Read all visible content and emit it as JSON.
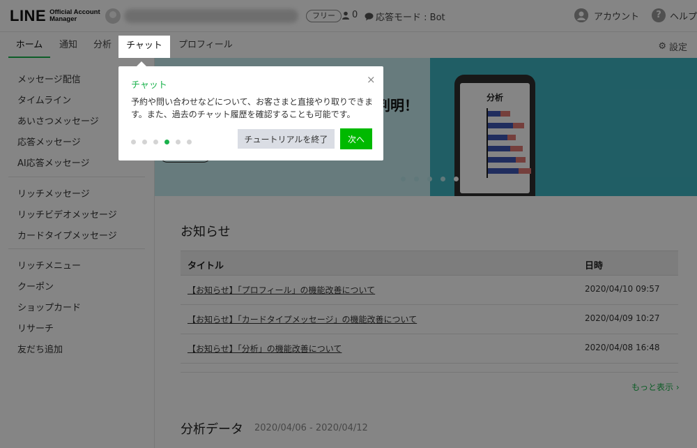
{
  "header": {
    "logo_main": "LINE",
    "logo_sub_1": "Official Account",
    "logo_sub_2": "Manager",
    "plan_badge": "フリー",
    "friend_count": "0",
    "response_mode": "応答モード : Bot",
    "account_label": "アカウント",
    "help_label": "ヘルプ"
  },
  "tabs": [
    {
      "label": "ホーム"
    },
    {
      "label": "通知"
    },
    {
      "label": "分析"
    },
    {
      "label": "チャット"
    },
    {
      "label": "プロフィール"
    }
  ],
  "settings_label": "設定",
  "sidebar": {
    "group1": [
      "メッセージ配信",
      "タイムライン",
      "あいさつメッセージ",
      "応答メッセージ",
      "AI応答メッセージ"
    ],
    "group2": [
      "リッチメッセージ",
      "リッチビデオメッセージ",
      "カードタイプメッセージ"
    ],
    "group3": [
      "リッチメニュー",
      "クーポン",
      "ショップカード",
      "リサーチ",
      "友だち追加"
    ]
  },
  "banner": {
    "headline_fragment": "判明！",
    "phone_title": "分析"
  },
  "news": {
    "heading": "お知らせ",
    "col_title": "タイトル",
    "col_date": "日時",
    "rows": [
      {
        "title": "【お知らせ】「プロフィール」の機能改善について",
        "date": "2020/04/10 09:57"
      },
      {
        "title": "【お知らせ】「カードタイプメッセージ」の機能改善について",
        "date": "2020/04/09 10:27"
      },
      {
        "title": "【お知らせ】「分析」の機能改善について",
        "date": "2020/04/08 16:48"
      }
    ],
    "more": "もっと表示"
  },
  "analytics": {
    "heading": "分析データ",
    "range": "2020/04/06 - 2020/04/12"
  },
  "tutorial": {
    "title": "チャット",
    "body": "予約や問い合わせなどについて、お客さまと直接やり取りできます。また、過去のチャット履歴を確認することも可能です。",
    "step_current": 4,
    "step_total": 6,
    "end_button": "チュートリアルを終了",
    "next_button": "次へ",
    "close_glyph": "×"
  },
  "colors": {
    "accent": "#1ab24c",
    "next_button": "#00b900",
    "banner_left": "#c5ecf0",
    "banner_right": "#3fb4c1"
  }
}
